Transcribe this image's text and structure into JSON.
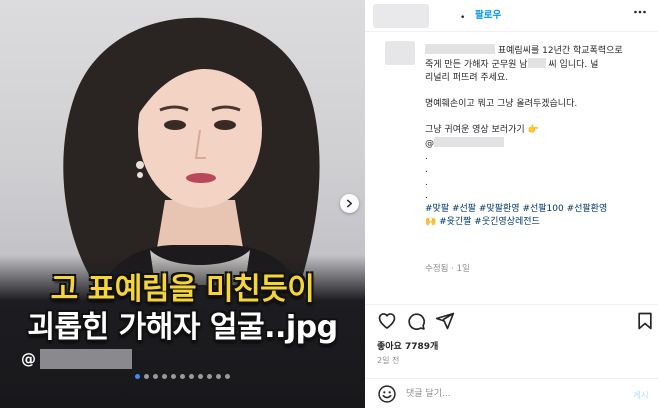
{
  "media": {
    "caption_line1": "고 표예림을 미친듯이",
    "caption_line2": "괴롭힌 가해자 얼굴..jpg",
    "handle_prefix": "@",
    "slide_count": 11,
    "active_slide": 1,
    "colors": {
      "caption_yellow": "#f5d53a",
      "caption_white": "#ffffff",
      "active_dot": "#3d8cf0"
    }
  },
  "header": {
    "separator": "•",
    "follow_label": "팔로우",
    "more_icon": "more-horizontal-icon"
  },
  "comment": {
    "line1_suffix": " 표예림씨를 12년간 학교폭력으로",
    "line2_prefix": "죽게 만든 가해자 군무원 남",
    "line2_suffix": " 씨 입니다. 널",
    "line3": "리널리 퍼뜨려 주세요.",
    "line4": "명예훼손이고 뭐고 그냥 올려두겠습니다.",
    "line5": "그냥 귀여운 영상 보러가기 👉",
    "line6_prefix": "@",
    "dot1": ".",
    "dot2": ".",
    "dot3": ".",
    "dot4": ".",
    "hashtags1": "#맞팔 #선팔 #맞팔환영 #선팔100 #선팔환영",
    "hashtags2": "🙌 #윳긴짤 #웃긴영상레전드",
    "meta": "수정됨 · 1일"
  },
  "actions": {
    "likes_label": "좋아요 7789개",
    "time_label": "2일 전"
  },
  "comment_bar": {
    "placeholder": "댓글 달기...",
    "post_label": "게시"
  }
}
